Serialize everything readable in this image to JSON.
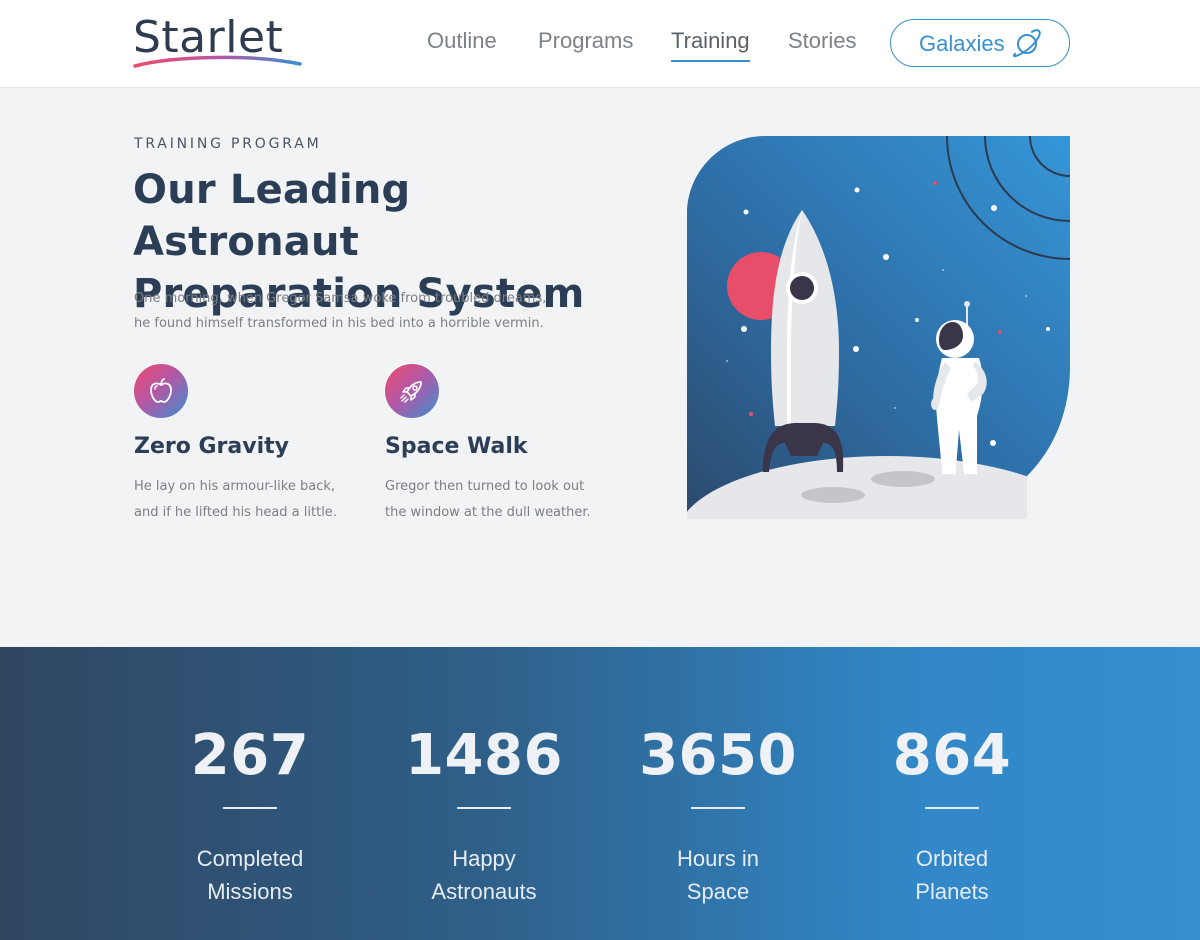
{
  "header": {
    "logo_text": "Starlet",
    "nav": [
      {
        "label": "Outline"
      },
      {
        "label": "Programs"
      },
      {
        "label": "Training"
      },
      {
        "label": "Stories"
      }
    ],
    "active_nav": "Training",
    "cta_label": "Galaxies",
    "cta_icon": "planet-icon"
  },
  "hero": {
    "eyebrow": "TRAINING PROGRAM",
    "title_line1": "Our Leading Astronaut",
    "title_line2": "Preparation System",
    "lead_line1": "One morning, when Gregor Samsa woke from troubled dreams,",
    "lead_line2": "he found himself transformed in his bed into a horrible vermin."
  },
  "features": [
    {
      "icon": "apple-icon",
      "title": "Zero Gravity",
      "line1": "He lay on his armour-like back,",
      "line2": "and if he lifted his head a little."
    },
    {
      "icon": "rocket-icon",
      "title": "Space Walk",
      "line1": "Gregor then turned to look out",
      "line2": "the window at the dull weather."
    }
  ],
  "stats": [
    {
      "value": "267",
      "line1": "Completed",
      "line2": "Missions"
    },
    {
      "value": "1486",
      "line1": "Happy",
      "line2": "Astronauts"
    },
    {
      "value": "3650",
      "line1": "Hours in",
      "line2": "Space"
    },
    {
      "value": "864",
      "line1": "Orbited",
      "line2": "Planets"
    }
  ],
  "colors": {
    "accent": "#3a8fd0",
    "heading": "#2c3e55",
    "icon_gradient_start": "#ee4b6a",
    "icon_gradient_end": "#3a8fd0",
    "stats_gradient_start": "#2f4661",
    "stats_gradient_end": "#348ed0"
  }
}
